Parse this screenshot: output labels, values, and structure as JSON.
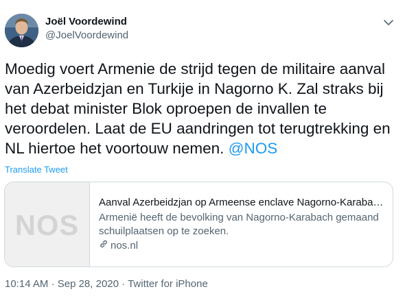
{
  "author": {
    "display_name": "Joël Voordewind",
    "handle": "@JoelVoordewind"
  },
  "tweet": {
    "text": "Moedig voert Armenie de strijd tegen de militaire aanval van Azerbeidzjan en Turkije in Nagorno K. Zal straks bij het debat minister Blok oproepen de invallen te veroordelen. Laat de EU aandringen tot terugtrekking en NL hiertoe het voortouw nemen. ",
    "mention": "@NOS",
    "translate_label": "Translate Tweet"
  },
  "card": {
    "thumb_logo": "NOS",
    "title": "Aanval Azerbeidzjan op Armeense enclave Nagorno-Karaba…",
    "description": "Armenië heeft de bevolking van Nagorno-Karabach gemaand schuilplaatsen op te zoeken.",
    "domain": "nos.nl",
    "domain_icon": "link-icon"
  },
  "meta": {
    "time": "10:14 AM",
    "separator": "·",
    "date": "Sep 28, 2020",
    "source": "Twitter for iPhone"
  },
  "colors": {
    "accent": "#1d9bf0",
    "secondary_text": "#536471",
    "primary_text": "#0f1419",
    "border": "#cfd9de"
  }
}
